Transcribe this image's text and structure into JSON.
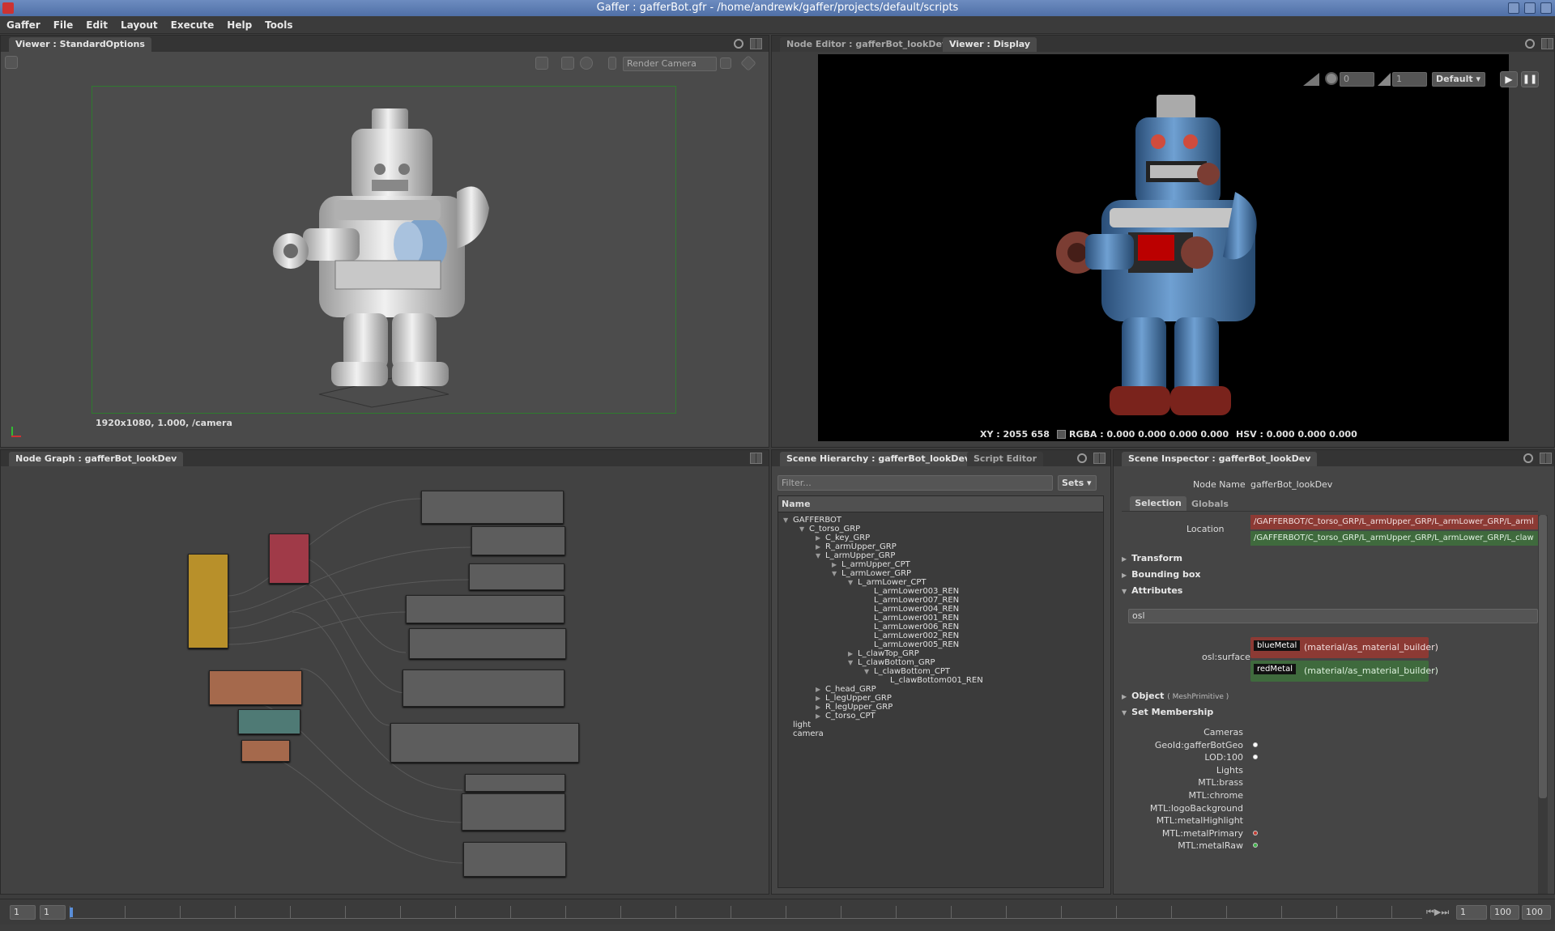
{
  "window": {
    "title": "Gaffer : gafferBot.gfr - /home/andrewk/gaffer/projects/default/scripts"
  },
  "menu": [
    "Gaffer",
    "File",
    "Edit",
    "Layout",
    "Execute",
    "Help",
    "Tools"
  ],
  "viewer_left": {
    "tab": "Viewer : StandardOptions",
    "camera_placeholder": "Render Camera",
    "resolution_label": "1920x1080, 1.000, /camera"
  },
  "viewer_right": {
    "tabs": [
      "Node Editor : gafferBot_lookDev",
      "Viewer : Display"
    ],
    "exposure": "0",
    "gamma": "1",
    "display_mode": "Default",
    "status": {
      "xy": "XY : 2055 658",
      "rgba": "RGBA : 0.000 0.000 0.000 0.000",
      "hsv": "HSV : 0.000 0.000 0.000"
    }
  },
  "node_graph": {
    "tab": "Node Graph : gafferBot_lookDev"
  },
  "hierarchy": {
    "tabs": [
      "Scene Hierarchy : gafferBot_lookDev",
      "Script Editor"
    ],
    "filter_placeholder": "Filter...",
    "sets_label": "Sets",
    "column": "Name",
    "rows": [
      {
        "label": "GAFFERBOT",
        "depth": 0,
        "arrow": "▼"
      },
      {
        "label": "C_torso_GRP",
        "depth": 1,
        "arrow": "▼"
      },
      {
        "label": "C_key_GRP",
        "depth": 2,
        "arrow": "▶"
      },
      {
        "label": "R_armUpper_GRP",
        "depth": 2,
        "arrow": "▶"
      },
      {
        "label": "L_armUpper_GRP",
        "depth": 2,
        "arrow": "▼"
      },
      {
        "label": "L_armUpper_CPT",
        "depth": 3,
        "arrow": "▶"
      },
      {
        "label": "L_armLower_GRP",
        "depth": 3,
        "arrow": "▼"
      },
      {
        "label": "L_armLower_CPT",
        "depth": 4,
        "arrow": "▼"
      },
      {
        "label": "L_armLower003_REN",
        "depth": 5,
        "arrow": ""
      },
      {
        "label": "L_armLower007_REN",
        "depth": 5,
        "arrow": ""
      },
      {
        "label": "L_armLower004_REN",
        "depth": 5,
        "arrow": ""
      },
      {
        "label": "L_armLower001_REN",
        "depth": 5,
        "arrow": ""
      },
      {
        "label": "L_armLower006_REN",
        "depth": 5,
        "arrow": ""
      },
      {
        "label": "L_armLower002_REN",
        "depth": 5,
        "arrow": ""
      },
      {
        "label": "L_armLower005_REN",
        "depth": 5,
        "arrow": ""
      },
      {
        "label": "L_clawTop_GRP",
        "depth": 4,
        "arrow": "▶"
      },
      {
        "label": "L_clawBottom_GRP",
        "depth": 4,
        "arrow": "▼"
      },
      {
        "label": "L_clawBottom_CPT",
        "depth": 5,
        "arrow": "▼"
      },
      {
        "label": "L_clawBottom001_REN",
        "depth": 6,
        "arrow": ""
      },
      {
        "label": "C_head_GRP",
        "depth": 2,
        "arrow": "▶"
      },
      {
        "label": "L_legUpper_GRP",
        "depth": 2,
        "arrow": "▶"
      },
      {
        "label": "R_legUpper_GRP",
        "depth": 2,
        "arrow": "▶"
      },
      {
        "label": "C_torso_CPT",
        "depth": 2,
        "arrow": "▶"
      },
      {
        "label": "light",
        "depth": 0,
        "arrow": ""
      },
      {
        "label": "camera",
        "depth": 0,
        "arrow": ""
      }
    ]
  },
  "inspector": {
    "tab": "Scene Inspector : gafferBot_lookDev",
    "node_name_label": "Node Name",
    "node_name": "gafferBot_lookDev",
    "subtabs": [
      "Selection",
      "Globals"
    ],
    "location_label": "Location",
    "location_a": "/GAFFERBOT/C_torso_GRP/L_armUpper_GRP/L_armLower_GRP/L_arml",
    "location_b": "/GAFFERBOT/C_torso_GRP/L_armUpper_GRP/L_armLower_GRP/L_claw",
    "sections": {
      "transform": "Transform",
      "bbox": "Bounding box",
      "attributes": "Attributes",
      "object": "Object",
      "object_type": "( MeshPrimitive )",
      "sets": "Set Membership"
    },
    "attr_filter": "osl",
    "osl_label": "osl:surface",
    "shader_a_name": "blueMetal",
    "shader_a_path": "(material/as_material_builder)",
    "shader_b_name": "redMetal",
    "shader_b_path": "(material/as_material_builder)",
    "set_rows": [
      {
        "label": "Cameras",
        "a": "none",
        "b": "none"
      },
      {
        "label": "GeoId:gafferBotGeo",
        "a": "dot",
        "b": "none"
      },
      {
        "label": "LOD:100",
        "a": "dot",
        "b": "none"
      },
      {
        "label": "Lights",
        "a": "none",
        "b": "none"
      },
      {
        "label": "MTL:brass",
        "a": "none",
        "b": "none"
      },
      {
        "label": "MTL:chrome",
        "a": "none",
        "b": "none"
      },
      {
        "label": "MTL:logoBackground",
        "a": "none",
        "b": "none"
      },
      {
        "label": "MTL:metalHighlight",
        "a": "none",
        "b": "none"
      },
      {
        "label": "MTL:metalPrimary",
        "a": "red",
        "b": "none"
      },
      {
        "label": "MTL:metalRaw",
        "a": "green",
        "b": "none"
      }
    ]
  },
  "timeline": {
    "start": "1",
    "current": "1",
    "frame": "1",
    "end": "100",
    "range_end": "100"
  },
  "colors": {
    "accent_red": "#8c3a34",
    "accent_green": "#3f6a3d",
    "robot_blue": "#4f7fb4"
  }
}
